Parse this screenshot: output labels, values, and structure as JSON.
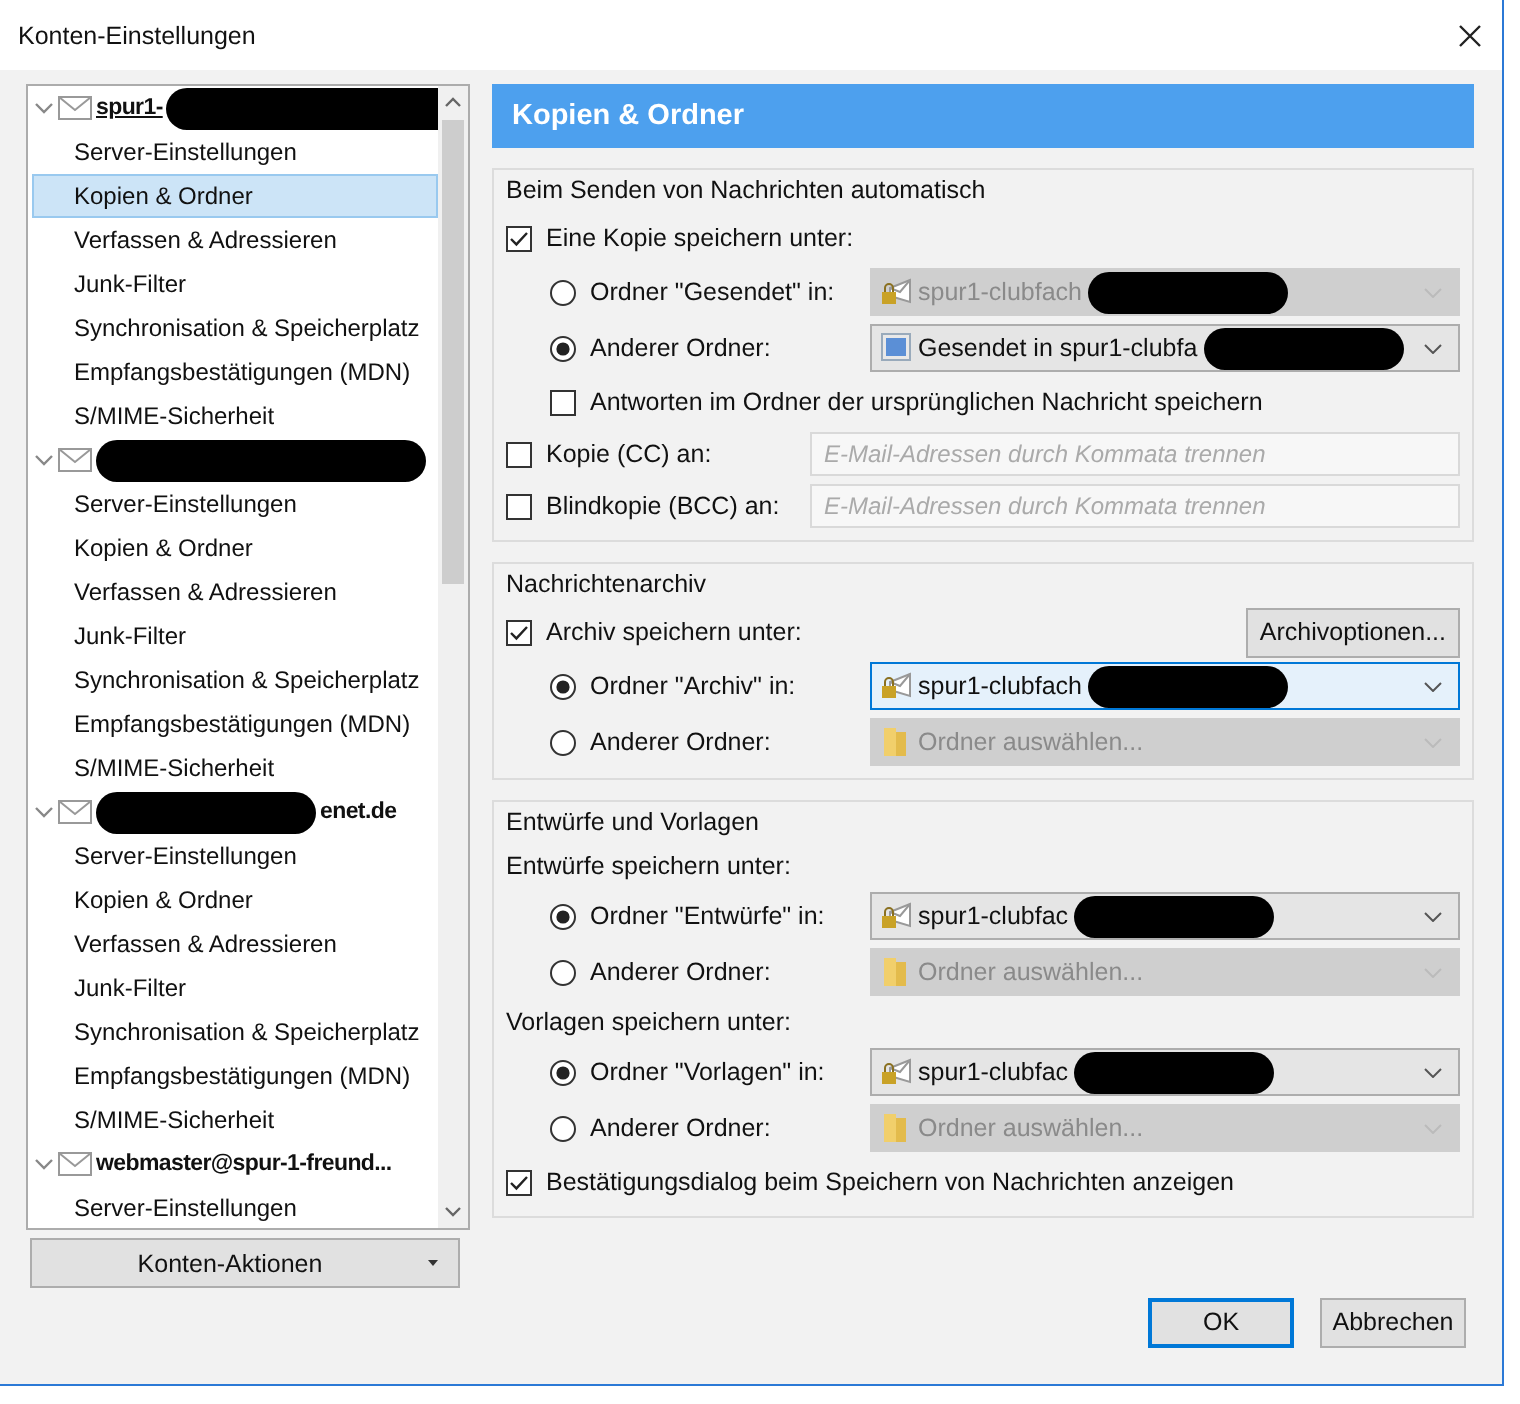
{
  "window": {
    "title": "Konten-Einstellungen"
  },
  "accounts": [
    {
      "name": "spur1-",
      "masked_before": false,
      "masked_after": true,
      "expanded": true,
      "children": [
        {
          "label": "Server-Einstellungen",
          "selected": false
        },
        {
          "label": "Kopien & Ordner",
          "selected": true
        },
        {
          "label": "Verfassen & Adressieren",
          "selected": false
        },
        {
          "label": "Junk-Filter",
          "selected": false
        },
        {
          "label": "Synchronisation & Speicherplatz",
          "selected": false
        },
        {
          "label": "Empfangsbestätigungen (MDN)",
          "selected": false
        },
        {
          "label": "S/MIME-Sicherheit",
          "selected": false
        }
      ]
    },
    {
      "masked_before": false,
      "masked_after": true,
      "expanded": true,
      "children": [
        {
          "label": "Server-Einstellungen",
          "selected": false
        },
        {
          "label": "Kopien & Ordner",
          "selected": false
        },
        {
          "label": "Verfassen & Adressieren",
          "selected": false
        },
        {
          "label": "Junk-Filter",
          "selected": false
        },
        {
          "label": "Synchronisation & Speicherplatz",
          "selected": false
        },
        {
          "label": "Empfangsbestätigungen (MDN)",
          "selected": false
        },
        {
          "label": "S/MIME-Sicherheit",
          "selected": false
        }
      ]
    },
    {
      "name": "enet.de",
      "masked_before": true,
      "masked_after": false,
      "expanded": true,
      "children": [
        {
          "label": "Server-Einstellungen",
          "selected": false
        },
        {
          "label": "Kopien & Ordner",
          "selected": false
        },
        {
          "label": "Verfassen & Adressieren",
          "selected": false
        },
        {
          "label": "Junk-Filter",
          "selected": false
        },
        {
          "label": "Synchronisation & Speicherplatz",
          "selected": false
        },
        {
          "label": "Empfangsbestätigungen (MDN)",
          "selected": false
        },
        {
          "label": "S/MIME-Sicherheit",
          "selected": false
        }
      ]
    },
    {
      "name": "webmaster@spur-1-freund...",
      "masked_before": false,
      "masked_after": false,
      "expanded": true,
      "children": [
        {
          "label": "Server-Einstellungen",
          "selected": false
        }
      ]
    }
  ],
  "account_actions": "Konten-Aktionen",
  "page_title": "Kopien & Ordner",
  "sections": [
    {
      "title": "Beim Senden von Nachrichten automatisch",
      "rows": [
        {
          "kind": "checkbox",
          "label": "Eine Kopie speichern unter:",
          "checked": true
        },
        {
          "kind": "radio",
          "label": "Ordner \"Gesendet\" in:",
          "selected": false,
          "select": {
            "kind": "account",
            "value": "spur1-clubfach",
            "disabled": true,
            "focused": false,
            "masked": true
          }
        },
        {
          "kind": "radio",
          "label": "Anderer Ordner:",
          "selected": true,
          "select": {
            "kind": "custom",
            "value": "Gesendet in spur1-clubfa",
            "disabled": false,
            "focused": false,
            "masked": true
          }
        },
        {
          "kind": "subcheckbox",
          "label": "Antworten im Ordner der ursprünglichen Nachricht speichern",
          "checked": false
        },
        {
          "kind": "checkfield",
          "label": "Kopie (CC) an:",
          "checked": false,
          "placeholder": "E-Mail-Adressen durch Kommata trennen"
        },
        {
          "kind": "checkfield",
          "label": "Blindkopie (BCC) an:",
          "checked": false,
          "placeholder": "E-Mail-Adressen durch Kommata trennen"
        }
      ]
    },
    {
      "title": "Nachrichtenarchiv",
      "rows": [
        {
          "kind": "checkbutton",
          "label": "Archiv speichern unter:",
          "checked": true,
          "button": "Archivoptionen..."
        },
        {
          "kind": "radio",
          "label": "Ordner \"Archiv\" in:",
          "selected": true,
          "select": {
            "kind": "account",
            "value": "spur1-clubfach",
            "disabled": false,
            "focused": true,
            "masked": true
          }
        },
        {
          "kind": "radio",
          "label": "Anderer Ordner:",
          "selected": false,
          "select": {
            "kind": "folder",
            "value": "Ordner auswählen...",
            "disabled": true,
            "focused": false,
            "masked": false
          }
        }
      ]
    },
    {
      "title": "Entwürfe und Vorlagen",
      "rows": [
        {
          "kind": "label",
          "label": "Entwürfe speichern unter:"
        },
        {
          "kind": "radio",
          "label": "Ordner \"Entwürfe\" in:",
          "selected": true,
          "select": {
            "kind": "account",
            "value": "spur1-clubfac",
            "disabled": false,
            "focused": false,
            "masked": true
          }
        },
        {
          "kind": "radio",
          "label": "Anderer Ordner:",
          "selected": false,
          "select": {
            "kind": "folder",
            "value": "Ordner auswählen...",
            "disabled": true,
            "focused": false,
            "masked": false
          }
        },
        {
          "kind": "label",
          "label": "Vorlagen speichern unter:"
        },
        {
          "kind": "radio",
          "label": "Ordner \"Vorlagen\" in:",
          "selected": true,
          "select": {
            "kind": "account",
            "value": "spur1-clubfac",
            "disabled": false,
            "focused": false,
            "masked": true
          }
        },
        {
          "kind": "radio",
          "label": "Anderer Ordner:",
          "selected": false,
          "select": {
            "kind": "folder",
            "value": "Ordner auswählen...",
            "disabled": true,
            "focused": false,
            "masked": false
          }
        },
        {
          "kind": "checkbox",
          "label": "Bestätigungsdialog beim Speichern von Nachrichten anzeigen",
          "checked": true
        }
      ]
    }
  ],
  "buttons": [
    {
      "label": "OK",
      "default": true
    },
    {
      "label": "Abbrechen",
      "default": false
    }
  ]
}
